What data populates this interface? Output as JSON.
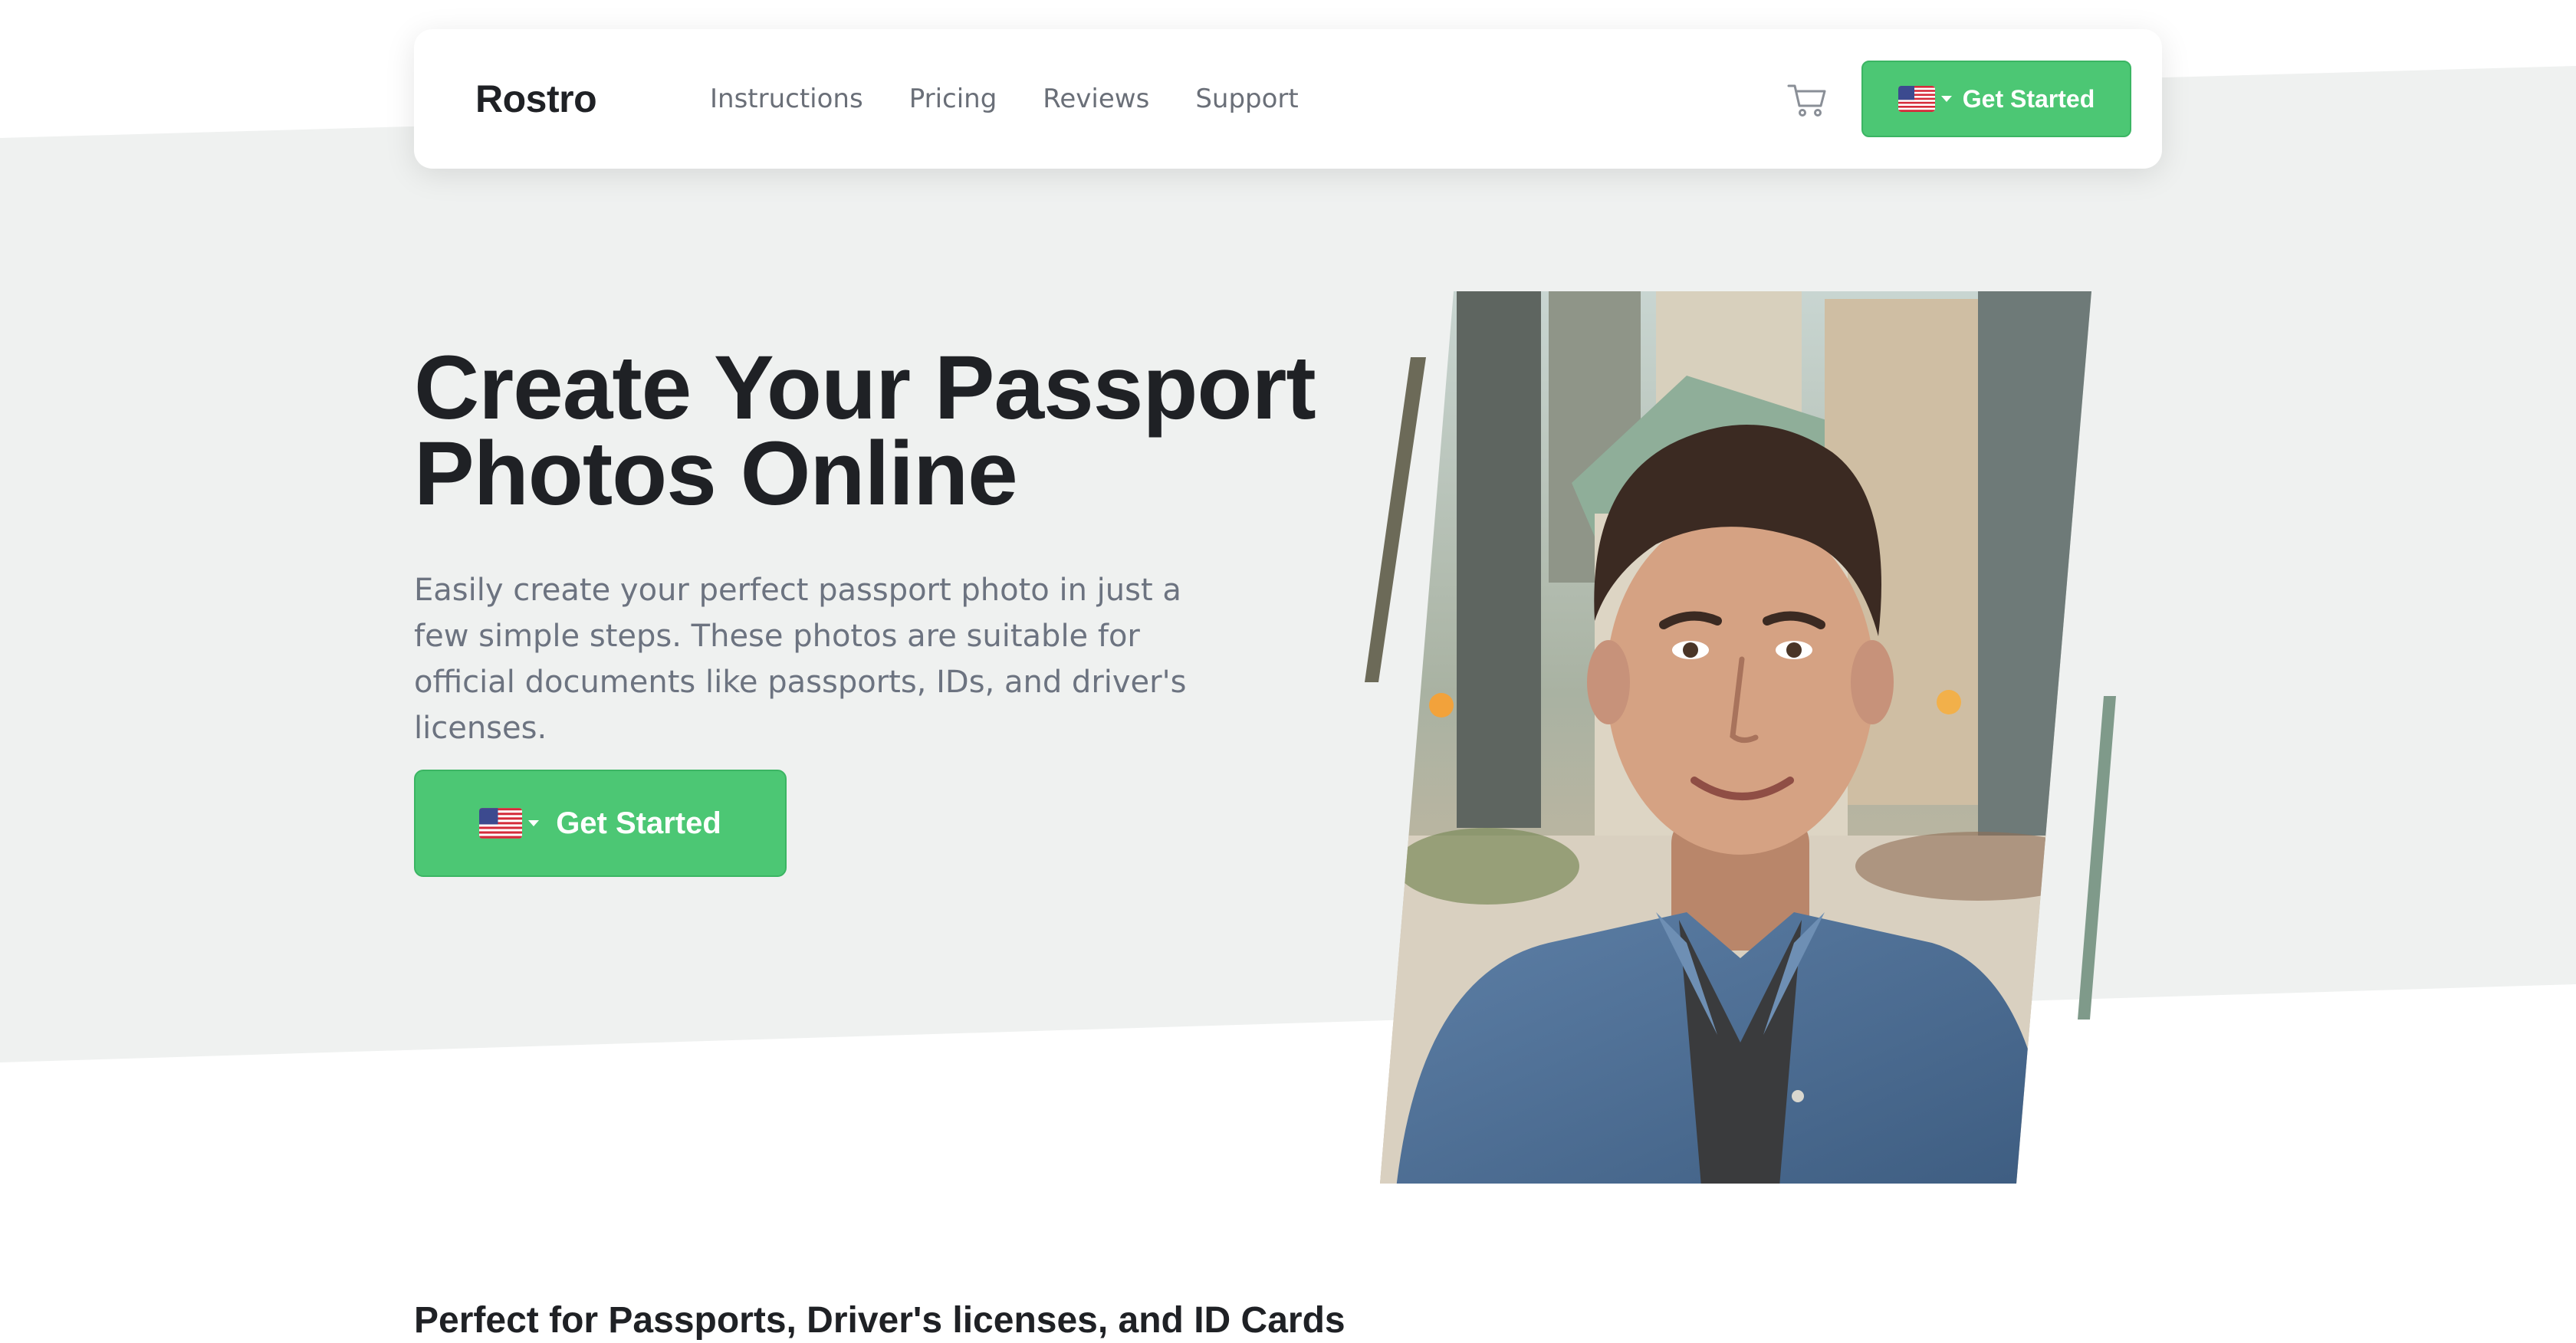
{
  "navbar": {
    "brand": "Rostro",
    "links": [
      "Instructions",
      "Pricing",
      "Reviews",
      "Support"
    ],
    "cart_icon": "cart-icon",
    "cta_label": "Get Started",
    "flag_icon": "us-flag-icon"
  },
  "hero": {
    "title_line1": "Create Your Passport",
    "title_line2": "Photos Online",
    "subtitle": "Easily create your perfect passport photo in just a few simple steps. These photos are suitable for official documents like passports, IDs, and driver's licenses.",
    "cta_label": "Get Started",
    "flag_icon": "us-flag-icon",
    "photo_subject": "portrait-photo"
  },
  "features": {
    "heading": "Perfect for Passports, Driver's licenses, and ID Cards"
  },
  "colors": {
    "accent_green": "#4cc774",
    "hero_background": "#eff1f0",
    "heading_text": "#1f2125",
    "body_text": "#6c7380"
  }
}
